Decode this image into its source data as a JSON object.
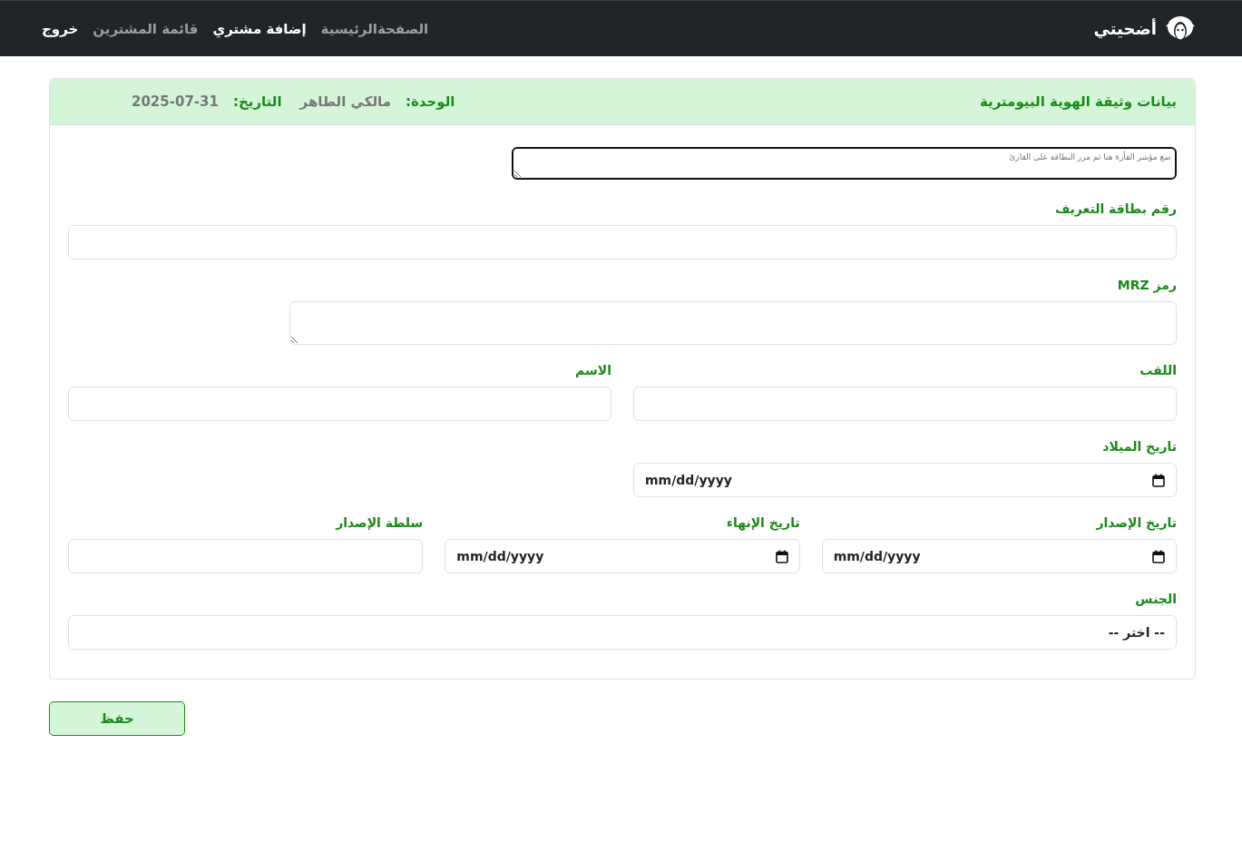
{
  "navbar": {
    "brand": "أضحيتي",
    "items": [
      {
        "label": "الصفحةالرئيسية",
        "selected": false
      },
      {
        "label": "إضافة مشتري",
        "selected": true
      },
      {
        "label": "قائمة المشترين",
        "selected": false
      }
    ],
    "logout": "خروج"
  },
  "card": {
    "title": "بيانات وثيقة الهوية البيومترية",
    "unit_label": "الوحدة:",
    "unit_value": "مالكي الطاهر",
    "date_label": "التاريخ:",
    "date_value": "2025-07-31",
    "card_reader": {
      "placeholder": "ضع مؤشر الفأرة هنا ثم مرر البطاقة على القارئ"
    },
    "rows": [
      [
        {
          "label": "رقم بطاقة التعريف",
          "kind": "input"
        }
      ],
      [
        {
          "label": "رمز MRZ",
          "kind": "textarea"
        }
      ],
      [
        {
          "label": "اللقب",
          "kind": "input"
        },
        {
          "label": "الاسم",
          "kind": "input"
        }
      ],
      [
        {
          "label": "تاريخ الميلاد",
          "kind": "date",
          "value": "mm/dd/yyyy"
        }
      ],
      [
        {
          "label": "تاريخ الإصدار",
          "kind": "date",
          "value": "mm/dd/yyyy"
        },
        {
          "label": "تاريخ الإنهاء",
          "kind": "date",
          "value": "mm/dd/yyyy"
        },
        {
          "label": "سلطة الإصدار",
          "kind": "input"
        }
      ],
      [
        {
          "label": "الجنس",
          "kind": "select",
          "value": "-- اختر --"
        }
      ]
    ]
  },
  "save_button": "حفظ"
}
